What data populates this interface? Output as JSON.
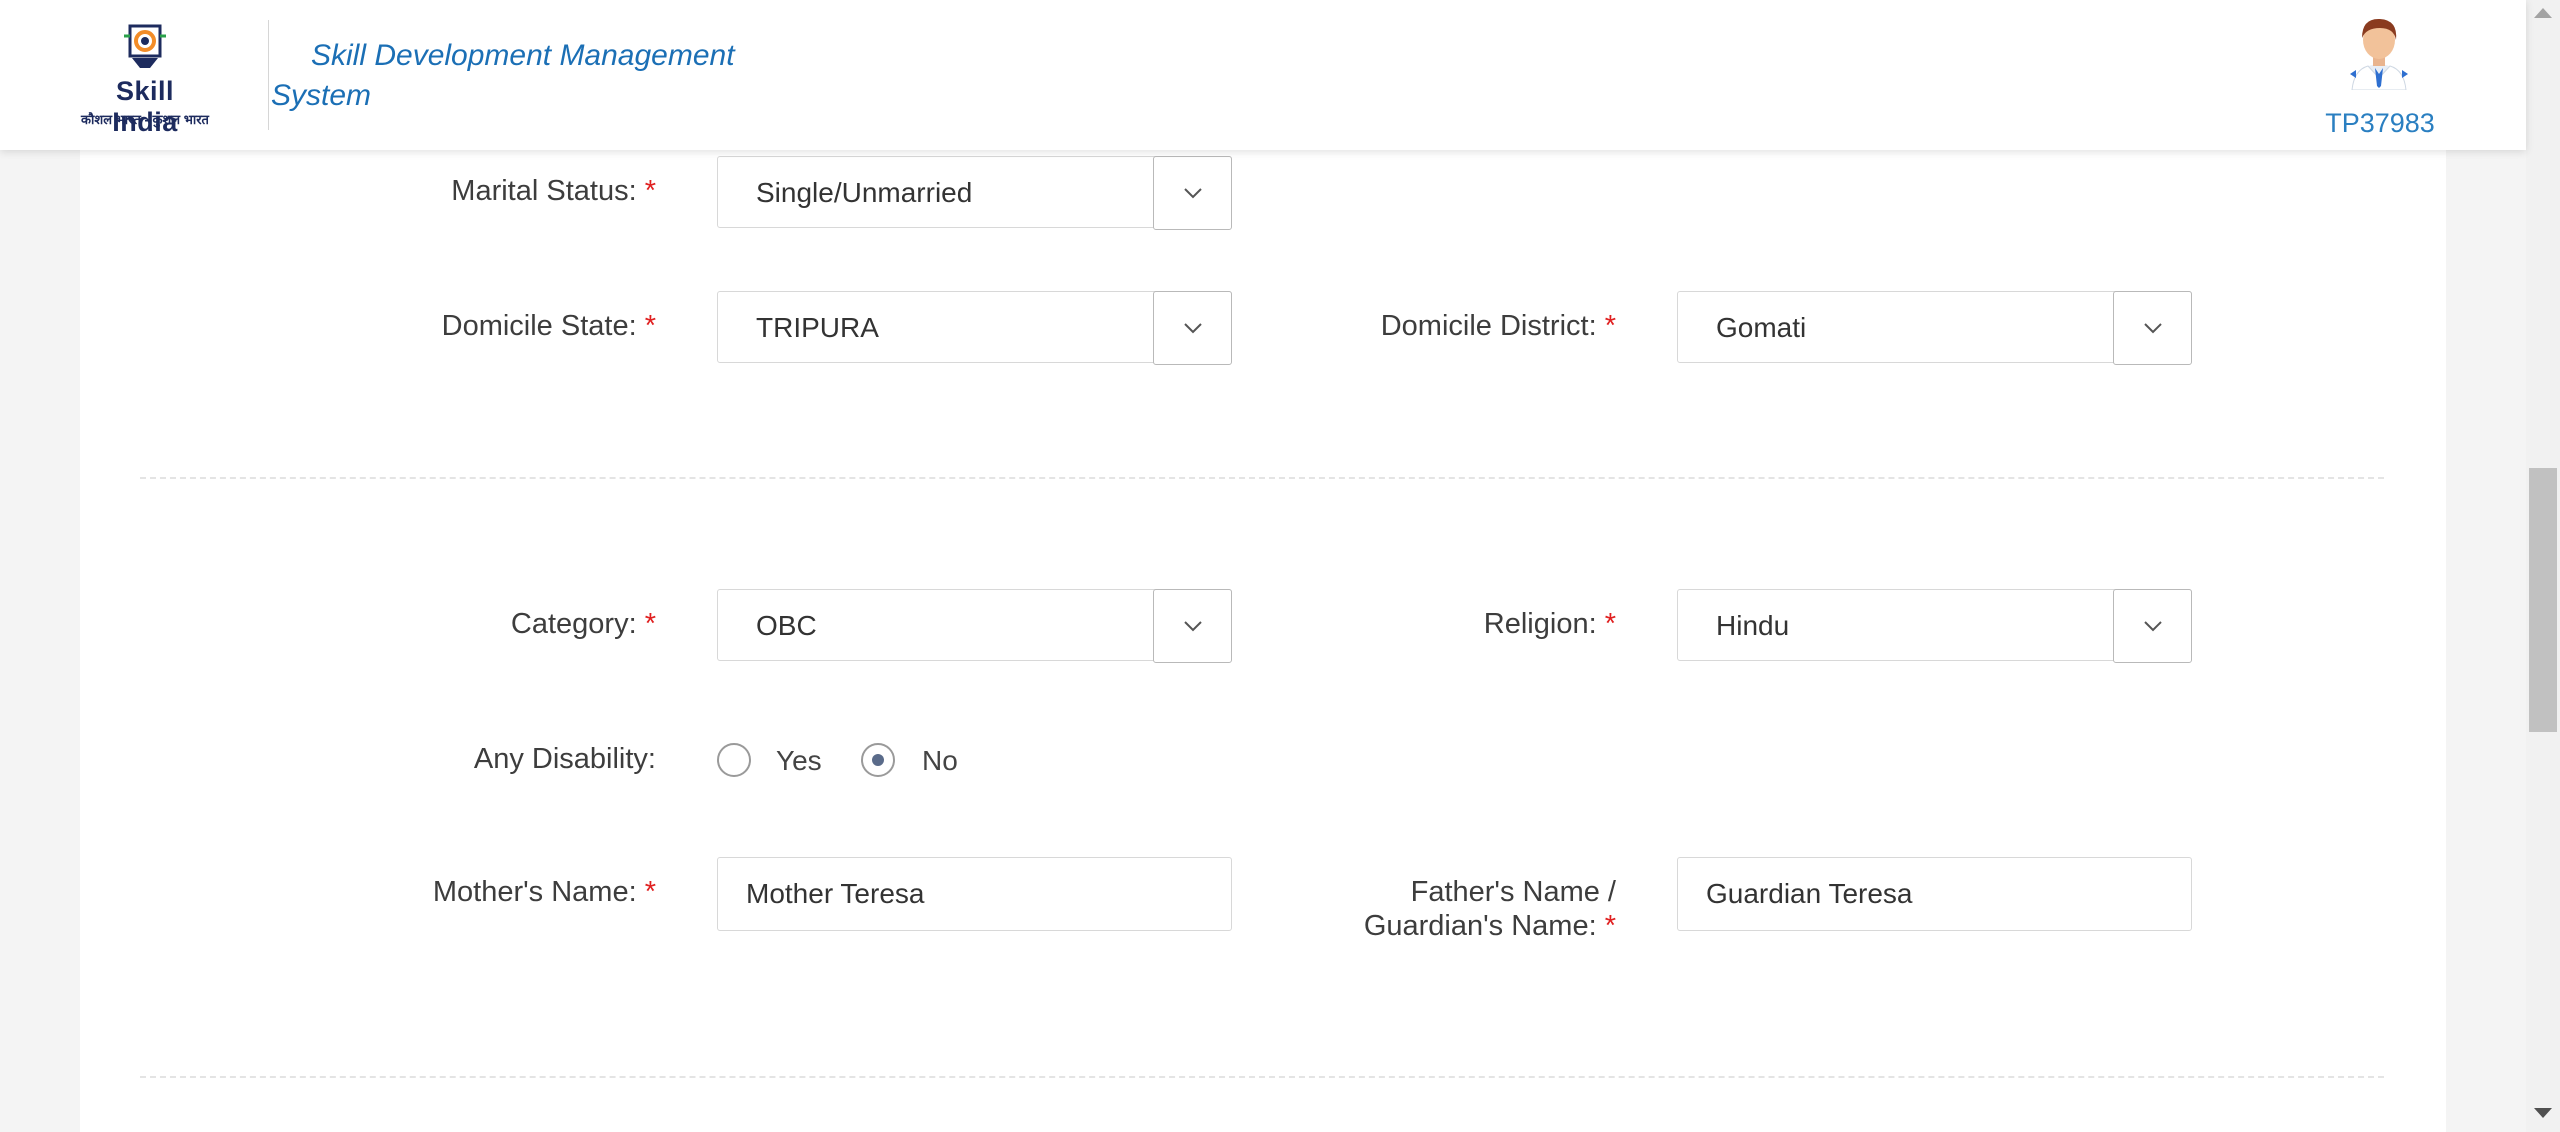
{
  "header": {
    "logo_text": "Skill India",
    "logo_tagline": "कौशल भारत - कुशल भारत",
    "system_name": "Skill Development Management System",
    "user_id": "TP37983"
  },
  "form": {
    "marital_status": {
      "label": "Marital Status:",
      "required": "*",
      "value": "Single/Unmarried"
    },
    "domicile_state": {
      "label": "Domicile State:",
      "required": "*",
      "value": "TRIPURA"
    },
    "domicile_district": {
      "label": "Domicile District:",
      "required": "*",
      "value": "Gomati"
    },
    "category": {
      "label": "Category:",
      "required": "*",
      "value": "OBC"
    },
    "religion": {
      "label": "Religion:",
      "required": "*",
      "value": "Hindu"
    },
    "disability": {
      "label": "Any Disability:",
      "options": [
        "Yes",
        "No"
      ],
      "selected": "No"
    },
    "mother_name": {
      "label": "Mother's Name:",
      "required": "*",
      "value": "Mother Teresa"
    },
    "father_name": {
      "label_line1": "Father's Name /",
      "label_line2": "Guardian's Name:",
      "required": "*",
      "value": "Guardian Teresa"
    }
  },
  "icons": {
    "dropdown": "chevron-down-icon",
    "logo": "skill-india-logo",
    "avatar": "user-avatar-icon"
  },
  "colors": {
    "brand_blue": "#1b6fb5",
    "required_red": "#e02020",
    "user_id_blue": "#2a7fc1"
  }
}
